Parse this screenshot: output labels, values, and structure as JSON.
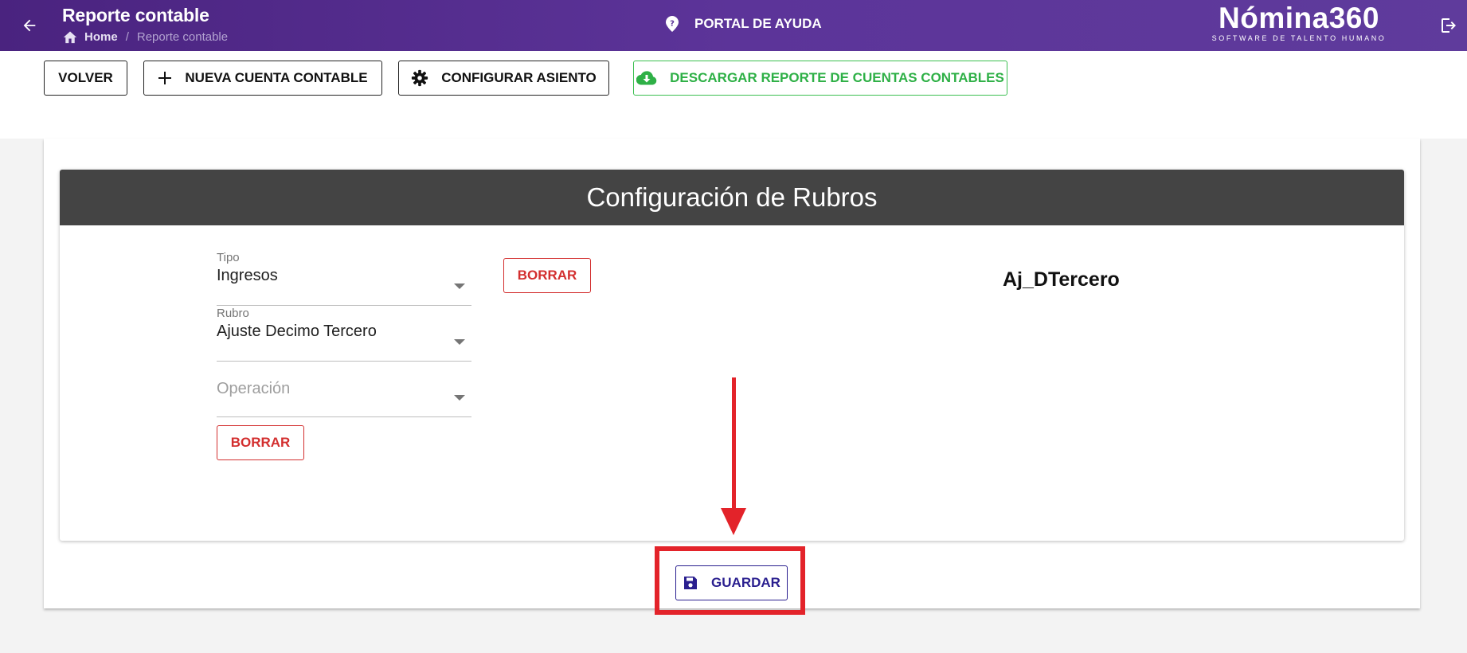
{
  "header": {
    "title": "Reporte contable",
    "breadcrumb": {
      "home": "Home",
      "current": "Reporte contable"
    },
    "help_label": "PORTAL DE AYUDA",
    "logo_main": "Nómina360",
    "logo_sub": "SOFTWARE DE TALENTO HUMANO"
  },
  "toolbar": {
    "back_label": "VOLVER",
    "new_account_label": "NUEVA CUENTA CONTABLE",
    "configure_label": "CONFIGURAR ASIENTO",
    "download_label": "DESCARGAR REPORTE DE CUENTAS CONTABLES"
  },
  "config": {
    "heading": "Configuración de Rubros",
    "tipo_label": "Tipo",
    "tipo_value": "Ingresos",
    "rubro_label": "Rubro",
    "rubro_value": "Ajuste Decimo Tercero",
    "operacion_placeholder": "Operación",
    "delete_label": "BORRAR",
    "code": "Aj_DTercero"
  },
  "actions": {
    "save_label": "GUARDAR"
  },
  "colors": {
    "header_bg": "#5c3499",
    "annotation_red": "#e3232a",
    "delete_red": "#d32f2f",
    "download_green": "#2eb046",
    "save_navy": "#2a1f8f"
  },
  "icons": {
    "back": "arrow-left-icon",
    "home": "home-icon",
    "help": "help-circle-icon",
    "logout": "logout-icon",
    "add": "plus-icon",
    "configure": "gear-icon",
    "download": "cloud-download-icon",
    "save": "floppy-disk-icon"
  }
}
